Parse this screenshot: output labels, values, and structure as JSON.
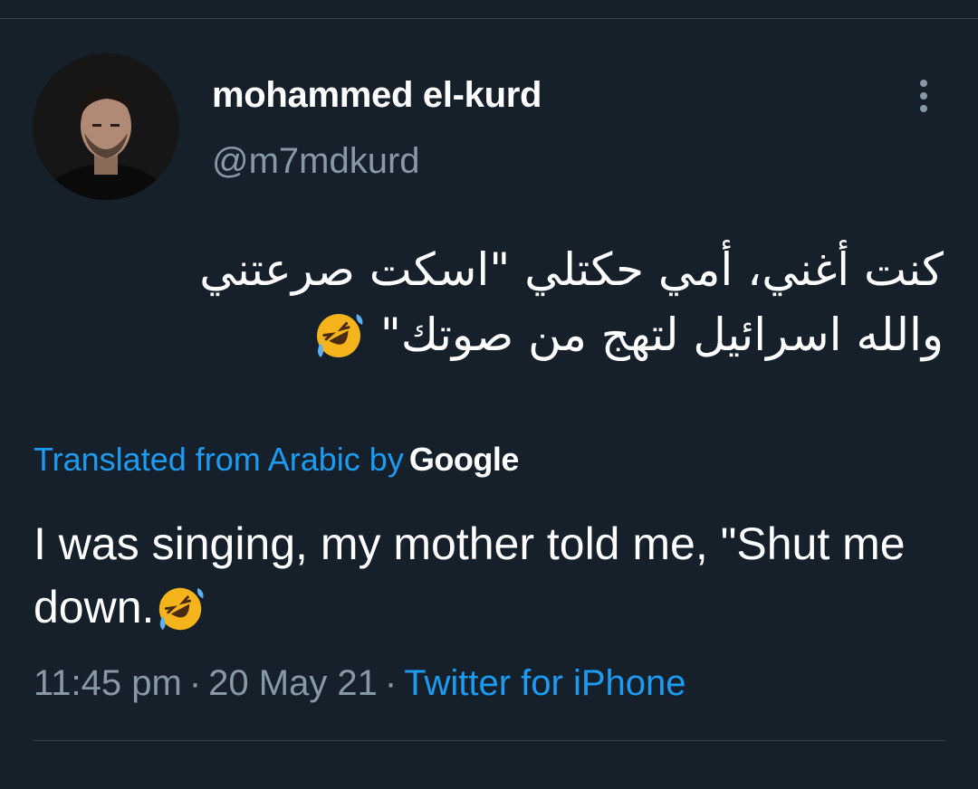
{
  "tweet": {
    "author": {
      "display_name": "mohammed el-kurd",
      "handle": "@m7mdkurd"
    },
    "more_icon": "vertical-ellipsis-icon",
    "text_arabic_line1": "كنت أغني، أمي حكتلي \"اسكت صرعتني",
    "text_arabic_line2": "والله اسرائيل لتهج من صوتك\" ",
    "emoji": "rolling-on-floor-laughing-emoji",
    "translation_label": "Translated from Arabic by",
    "translation_provider": "Google",
    "text_translated": "I was singing, my mother told me, \"Shut me down.",
    "time": "11:45 pm",
    "separator": "·",
    "date": "20 May 21",
    "source": "Twitter for iPhone"
  },
  "colors": {
    "background": "#15202b",
    "text": "#ffffff",
    "secondary": "#8899a6",
    "accent": "#1d9bf0",
    "divider": "#38444d"
  }
}
